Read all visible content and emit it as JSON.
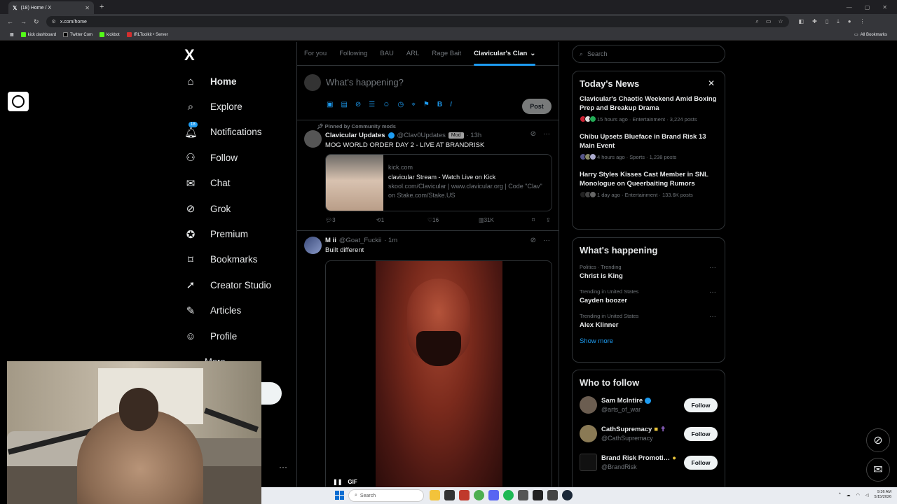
{
  "browser": {
    "tab_title": "(18) Home / X",
    "url": "x.com/home",
    "bookmarks": [
      "kick dashboard",
      "Twitter Com",
      "kickbot",
      "IRLToolkit • Server"
    ],
    "bookmarks_all": "All Bookmarks"
  },
  "nav": {
    "logo": "X",
    "items": [
      {
        "label": "Home",
        "icon": "home-icon"
      },
      {
        "label": "Explore",
        "icon": "search-icon"
      },
      {
        "label": "Notifications",
        "icon": "bell-icon",
        "badge": "18"
      },
      {
        "label": "Follow",
        "icon": "add-person-icon"
      },
      {
        "label": "Chat",
        "icon": "mail-icon"
      },
      {
        "label": "Grok",
        "icon": "grok-icon"
      },
      {
        "label": "Premium",
        "icon": "premium-icon"
      },
      {
        "label": "Bookmarks",
        "icon": "bookmark-icon"
      },
      {
        "label": "Creator Studio",
        "icon": "rocket-icon"
      },
      {
        "label": "Articles",
        "icon": "articles-icon"
      },
      {
        "label": "Profile",
        "icon": "person-icon"
      }
    ],
    "more_label": "More"
  },
  "feed": {
    "tabs": [
      "For you",
      "Following",
      "BAU",
      "ARL",
      "Rage Bait",
      "Clavicular's Clan"
    ],
    "active_tab": "Clavicular's Clan",
    "compose_placeholder": "What's happening?",
    "post_button": "Post"
  },
  "tweet1": {
    "pinned_label": "Pinned by Community mods",
    "name": "Clavicular Updates",
    "handle": "@Clav0Updates",
    "mod_badge": "Mod",
    "time": "· 13h",
    "text": "MOG WORLD ORDER DAY 2 - LIVE AT BRANDRISK",
    "card_domain": "kick.com",
    "card_title": "clavicular Stream - Watch Live on Kick",
    "card_desc": "skool.com/Clavicular | www.clavicular.org | Code \"Clav\" on Stake.com/Stake.US",
    "replies": "3",
    "reposts": "1",
    "likes": "16",
    "views": "31K"
  },
  "tweet2": {
    "name": "M ii",
    "handle": "@Goat_Fuckii",
    "time": "· 1m",
    "text": "Built different",
    "gif_label": "GIF"
  },
  "sidebar": {
    "search_placeholder": "Search",
    "news_title": "Today's News",
    "news": [
      {
        "title": "Clavicular's Chaotic Weekend Amid Boxing Prep and Breakup Drama",
        "meta": "15 hours ago · Entertainment · 3,224 posts"
      },
      {
        "title": "Chibu Upsets Blueface in Brand Risk 13 Main Event",
        "meta": "4 hours ago · Sports · 1,238 posts"
      },
      {
        "title": "Harry Styles Kisses Cast Member in SNL Monologue on Queerbaiting Rumors",
        "meta": "1 day ago · Entertainment · 133.6K posts"
      }
    ],
    "happening_title": "What's happening",
    "trends": [
      {
        "context": "Politics · Trending",
        "name": "Christ is King"
      },
      {
        "context": "Trending in United States",
        "name": "Cayden boozer"
      },
      {
        "context": "Trending in United States",
        "name": "Alex Klinner"
      }
    ],
    "show_more": "Show more",
    "wtf_title": "Who to follow",
    "follow_label": "Follow",
    "who_to_follow": [
      {
        "name": "Sam McIntire",
        "handle": "@arts_of_war"
      },
      {
        "name": "CathSupremacy",
        "handle": "@CathSupremacy"
      },
      {
        "name": "Brand Risk Promoti…",
        "handle": "@BrandRisk"
      }
    ]
  },
  "taskbar": {
    "search_placeholder": "Search",
    "time": "9:36 AM",
    "date": "5/15/2026"
  }
}
